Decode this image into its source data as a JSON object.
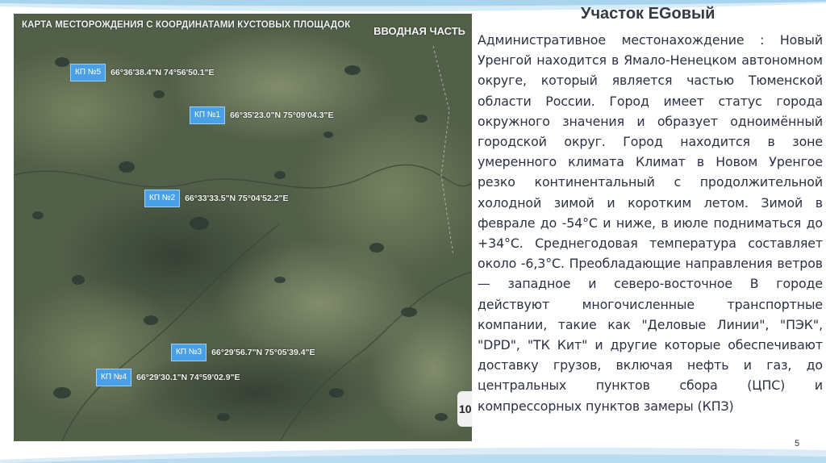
{
  "slide": {
    "title": "Участок EGовый",
    "number": "5",
    "body": "Административное местонахождение : Новый Уренгой находится в Ямало-Ненецком автономном округе, который является частью Тюменской области России. Город имеет статус города окружного значения и образует одноимённый городской округ. Город находится в зоне умеренного климата Климат в Новом Уренгое резко континентальный с продолжительной холодной зимой и коротким летом. Зимой в феврале до -54°С и ниже, в июле подниматься до +34°С. Среднегодовая температура составляет около -6,3°С. Преобладающие направления ветров — западное и северо-восточное В городе действуют многочисленные транспортные компании, такие как \"Деловые Линии\", \"ПЭК\", \"DPD\", \"ТК Кит\" и другие которые обеспечивают доставку грузов, включая нефть и газ, до центральных пунктов сбора (ЦПС) и компрессорных пунктов замеры (КПЗ)"
  },
  "map": {
    "title": "КАРТА МЕСТОРОЖДЕНИЯ С КООРДИНАТАМИ КУСТОВЫХ ПЛОЩАДОК",
    "part_label": "ВВОДНАЯ ЧАСТЬ",
    "page_tab": "10",
    "badge_color": "#4aa0e6",
    "pads": [
      {
        "label": "КП №5",
        "coords": "66°36'38.4\"N 74°56'50.1\"E"
      },
      {
        "label": "КП №1",
        "coords": "66°35'23.0\"N 75°09'04.3\"E"
      },
      {
        "label": "КП №2",
        "coords": "66°33'33.5\"N 75°04'52.2\"E"
      },
      {
        "label": "КП №3",
        "coords": "66°29'56.7\"N 75°05'39.4\"E"
      },
      {
        "label": "КП №4",
        "coords": "66°29'30.1\"N 74°59'02.9\"E"
      }
    ]
  },
  "colors": {
    "accent_blue": "#a9d4ee",
    "text": "#2b3140",
    "map_base": "#4f5c46"
  }
}
